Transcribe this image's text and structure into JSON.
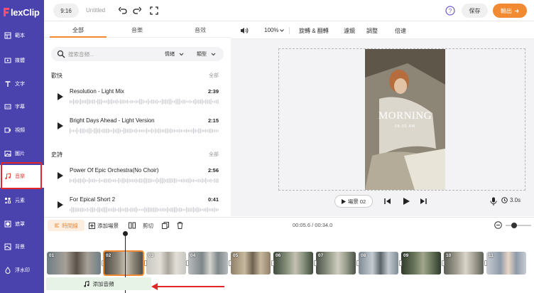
{
  "app": {
    "logo_text": "lexClip",
    "colors": {
      "brand": "#4a42ad",
      "accent": "#f18a30",
      "highlight": "#e3262a"
    }
  },
  "sidebar": {
    "items": [
      {
        "label": "範本",
        "icon": "template-icon"
      },
      {
        "label": "媒體",
        "icon": "media-icon"
      },
      {
        "label": "文字",
        "icon": "text-icon"
      },
      {
        "label": "字幕",
        "icon": "subtitle-icon"
      },
      {
        "label": "視頻",
        "icon": "video-icon"
      },
      {
        "label": "圖片",
        "icon": "image-icon"
      },
      {
        "label": "音樂",
        "icon": "music-icon",
        "active": true
      },
      {
        "label": "元素",
        "icon": "elements-icon"
      },
      {
        "label": "遮罩",
        "icon": "mask-icon"
      },
      {
        "label": "背景",
        "icon": "background-icon"
      },
      {
        "label": "浮水印",
        "icon": "watermark-icon"
      }
    ]
  },
  "topbar": {
    "ratio": "9:16",
    "title": "Untitled",
    "save_label": "保存",
    "export_label": "輸出"
  },
  "panel": {
    "tabs": [
      "全部",
      "音樂",
      "音效"
    ],
    "search_placeholder": "搜索音頻...",
    "filter_mood": "情緒",
    "filter_genre": "類型",
    "categories": [
      {
        "title": "歡快",
        "all_label": "全部",
        "tracks": [
          {
            "name": "Resolution - Light Mix",
            "duration": "2:39"
          },
          {
            "name": "Bright Days Ahead - Light Version",
            "duration": "2:15"
          }
        ]
      },
      {
        "title": "史詩",
        "all_label": "全部",
        "tracks": [
          {
            "name": "Power Of Epic Orchestra(No Choir)",
            "duration": "2:56"
          },
          {
            "name": "For Epical Short 2",
            "duration": "0:41"
          }
        ]
      }
    ]
  },
  "preview_toolbar": {
    "zoom": "100%",
    "rotate_crop": "旋轉 & 翻轉",
    "filter": "濾鏡",
    "adjust": "調整",
    "speed": "倍速"
  },
  "preview": {
    "title": "MORNING",
    "subtitle": "08:30 AM",
    "scene_label": "場景 02",
    "speed_value": "3.0s"
  },
  "timeline_toolbar": {
    "timeline_label": "時間線",
    "add_scene": "添加場景",
    "split": "剪切",
    "time_display": "00:05.6 / 00:34.0"
  },
  "timeline": {
    "clips": [
      "01",
      "02",
      "03",
      "04",
      "05",
      "06",
      "07",
      "08",
      "09",
      "10",
      "11"
    ],
    "selected_clip": "02",
    "add_audio_label": "添加音頻"
  }
}
